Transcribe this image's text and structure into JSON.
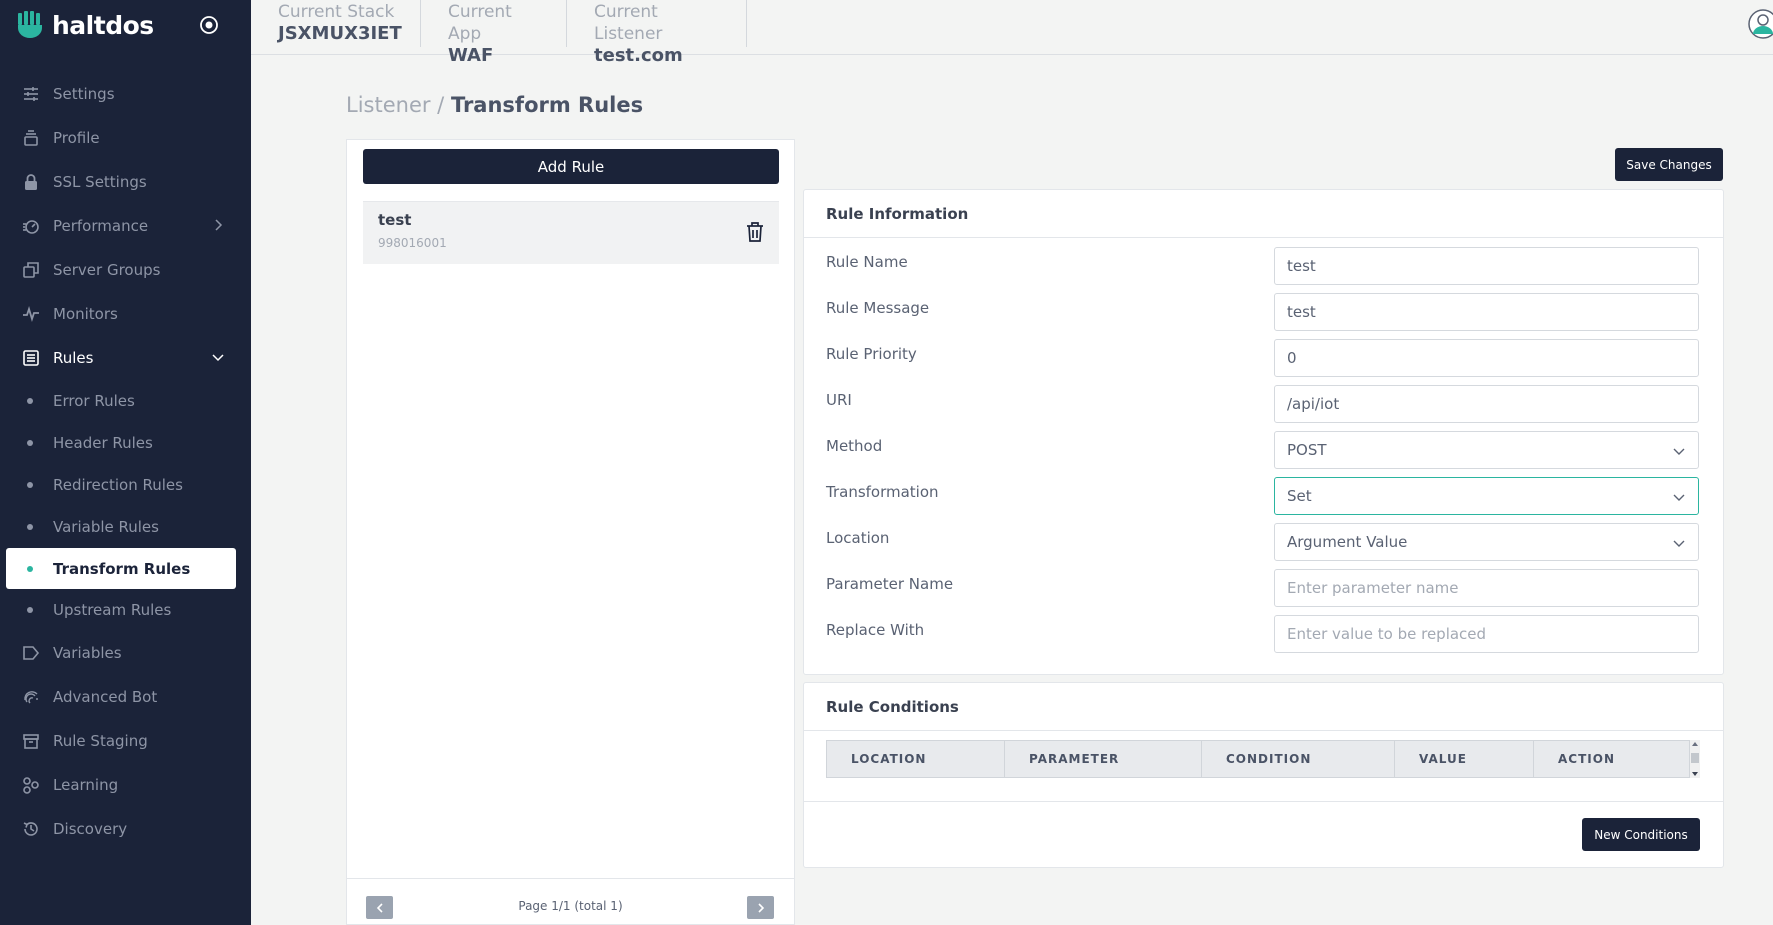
{
  "brand": {
    "name": "haltdos",
    "accent": "#2bb5a0",
    "sidebar_bg": "#1b2339"
  },
  "sidebar": {
    "items": [
      {
        "label": "Settings",
        "icon": "sliders-icon"
      },
      {
        "label": "Profile",
        "icon": "stack-icon"
      },
      {
        "label": "SSL Settings",
        "icon": "lock-icon"
      },
      {
        "label": "Performance",
        "icon": "gauge-icon"
      },
      {
        "label": "Server Groups",
        "icon": "copy-icon"
      },
      {
        "label": "Monitors",
        "icon": "pulse-icon"
      },
      {
        "label": "Rules",
        "icon": "list-icon"
      }
    ],
    "rules_sub": [
      {
        "label": "Error Rules"
      },
      {
        "label": "Header Rules"
      },
      {
        "label": "Redirection Rules"
      },
      {
        "label": "Variable Rules"
      },
      {
        "label": "Transform Rules"
      },
      {
        "label": "Upstream Rules"
      }
    ],
    "items_after": [
      {
        "label": "Variables",
        "icon": "tag-icon"
      },
      {
        "label": "Advanced Bot",
        "icon": "fingerprint-icon"
      },
      {
        "label": "Rule Staging",
        "icon": "archive-icon"
      },
      {
        "label": "Learning",
        "icon": "nodes-icon"
      },
      {
        "label": "Discovery",
        "icon": "history-icon"
      }
    ]
  },
  "topbar": {
    "stack": {
      "label": "Current Stack",
      "value": "JSXMUX3IET"
    },
    "app": {
      "label": "Current App",
      "value": "WAF"
    },
    "listener": {
      "label": "Current Listener",
      "value": "test.com"
    }
  },
  "breadcrumb": {
    "parent": "Listener",
    "separator": " / ",
    "current": "Transform Rules"
  },
  "list": {
    "add_label": "Add Rule",
    "rules": [
      {
        "name": "test",
        "id": "998016001"
      }
    ],
    "pager_text": "Page 1/1 (total 1)"
  },
  "save_label": "Save Changes",
  "info": {
    "title": "Rule Information",
    "rule_name": {
      "label": "Rule Name",
      "value": "test"
    },
    "rule_message": {
      "label": "Rule Message",
      "value": "test"
    },
    "rule_priority": {
      "label": "Rule Priority",
      "value": "0"
    },
    "uri": {
      "label": "URI",
      "value": "/api/iot"
    },
    "method": {
      "label": "Method",
      "value": "POST"
    },
    "transformation": {
      "label": "Transformation",
      "value": "Set"
    },
    "location": {
      "label": "Location",
      "value": "Argument Value"
    },
    "parameter_name": {
      "label": "Parameter Name",
      "placeholder": "Enter parameter name"
    },
    "replace_with": {
      "label": "Replace With",
      "placeholder": "Enter value to be replaced"
    }
  },
  "conditions": {
    "title": "Rule Conditions",
    "columns": [
      "LOCATION",
      "PARAMETER",
      "CONDITION",
      "VALUE",
      "ACTION"
    ],
    "new_label": "New Conditions"
  }
}
